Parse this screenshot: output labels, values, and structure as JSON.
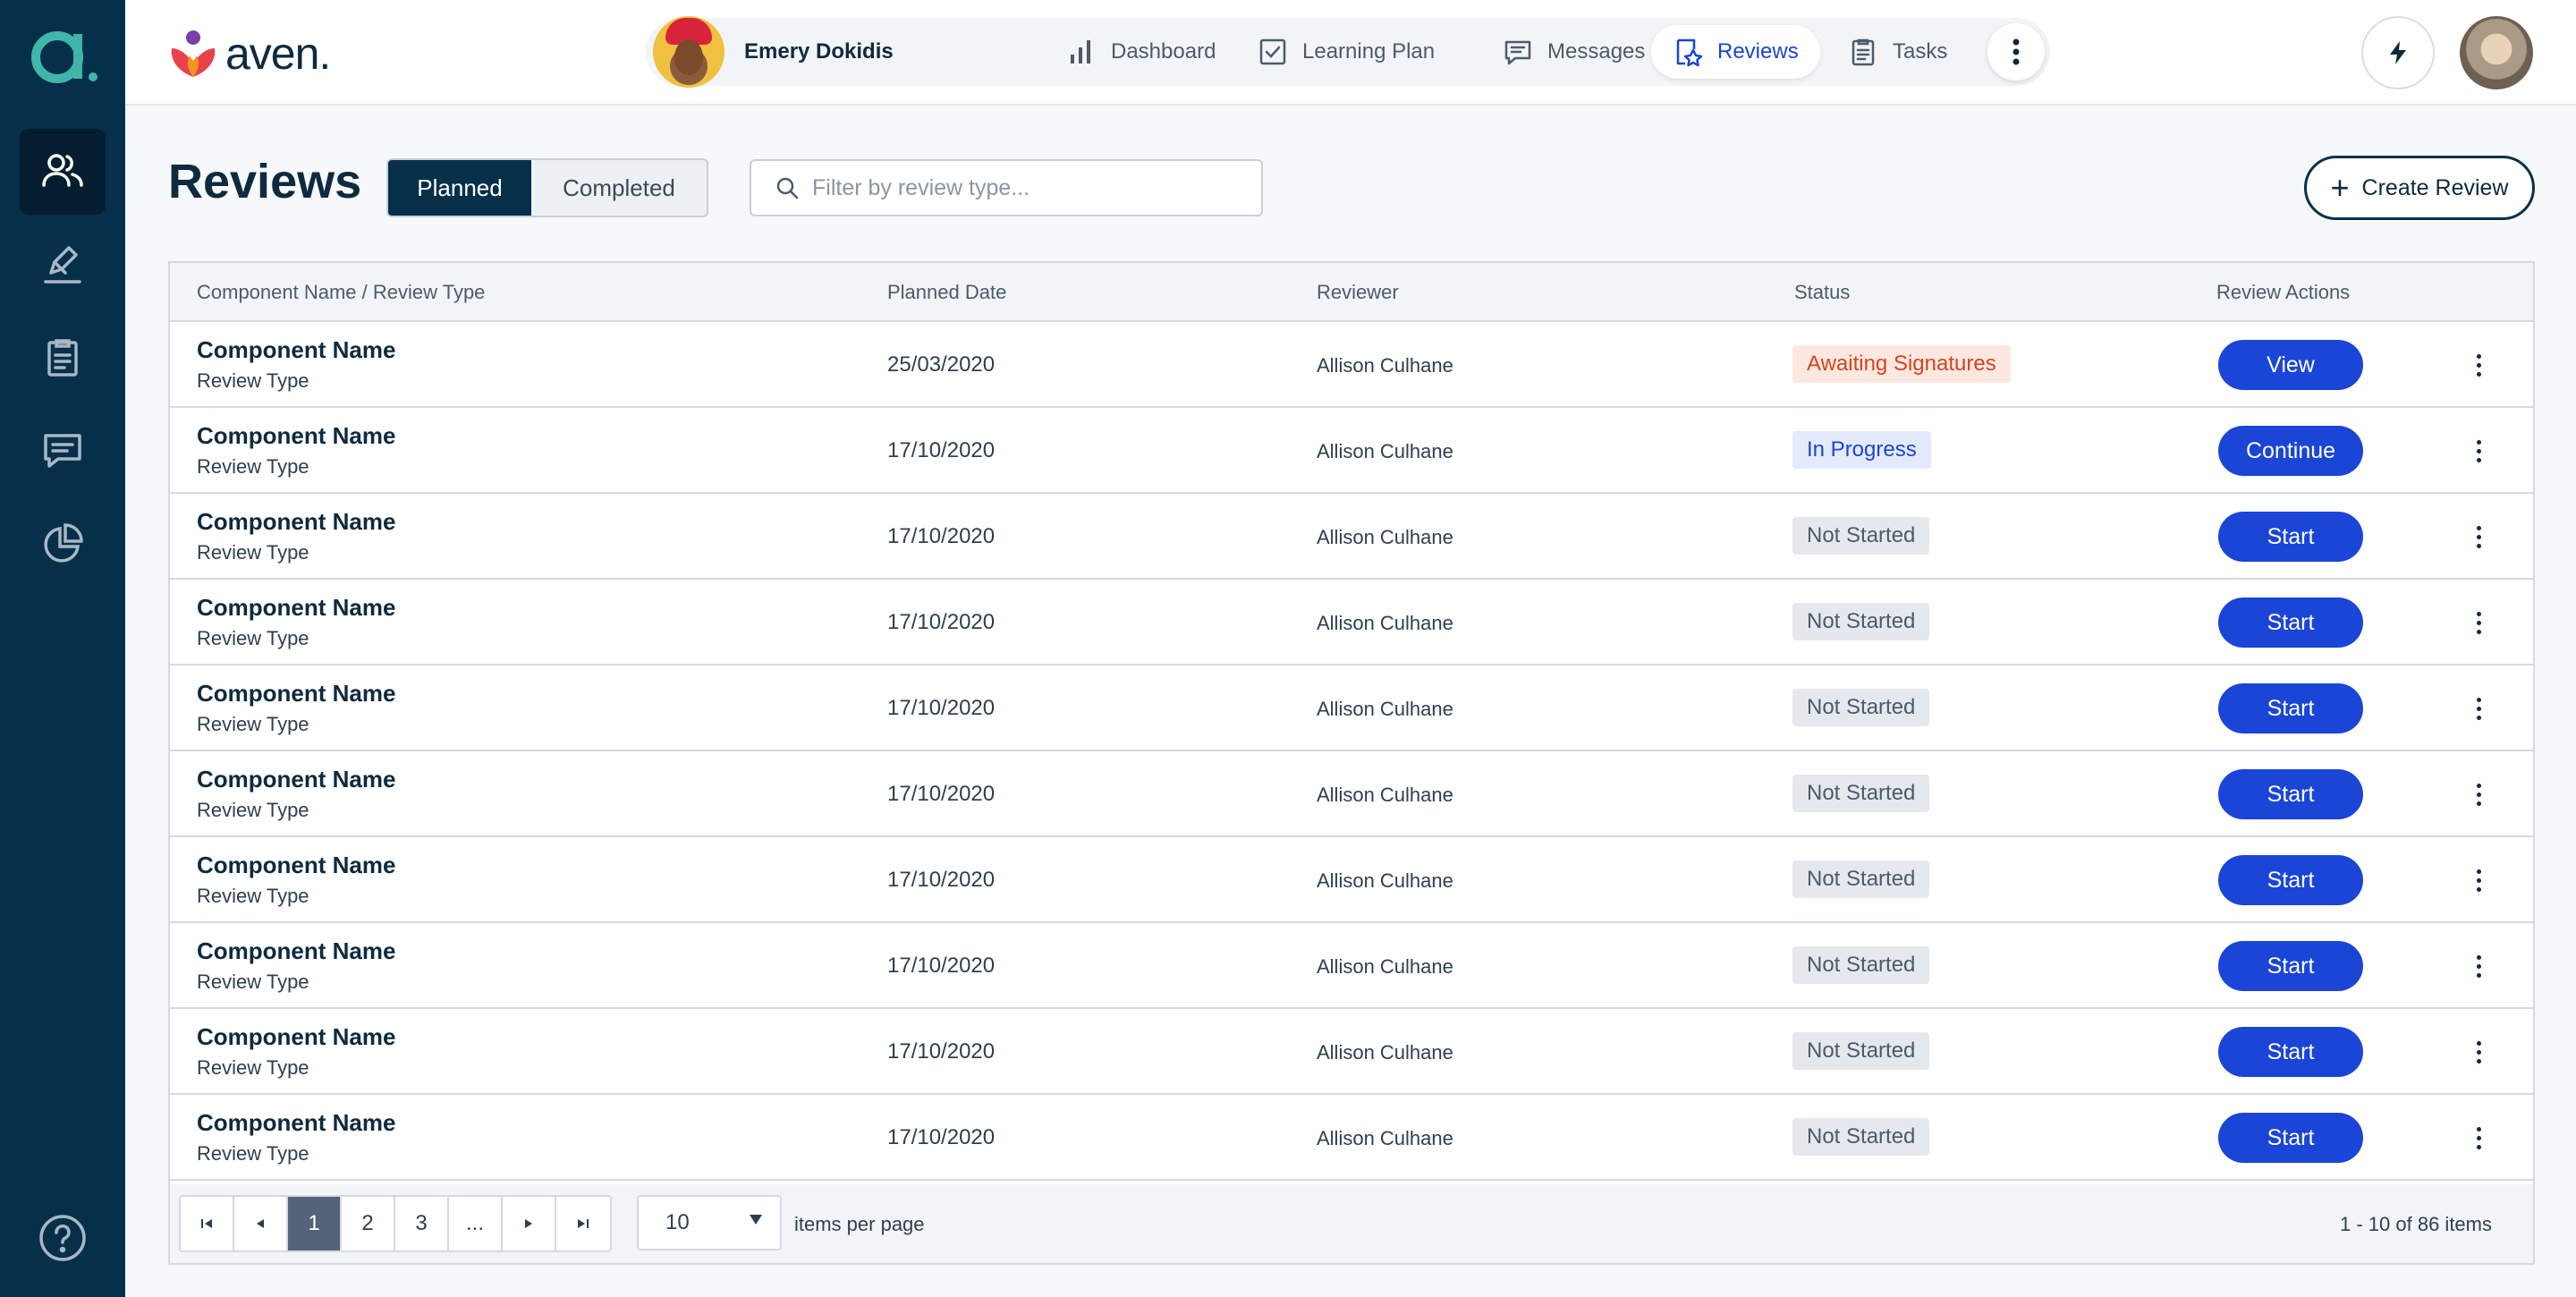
{
  "brand": {
    "name": "aven."
  },
  "nav": {
    "user_name": "Emery Dokidis",
    "items": [
      {
        "label": "Dashboard",
        "icon": "bar-chart-icon"
      },
      {
        "label": "Learning Plan",
        "icon": "checkbox-icon"
      },
      {
        "label": "Messages",
        "icon": "chat-icon"
      },
      {
        "label": "Reviews",
        "icon": "review-star-icon",
        "active": true
      },
      {
        "label": "Tasks",
        "icon": "clipboard-icon"
      }
    ]
  },
  "page": {
    "title": "Reviews",
    "segments": {
      "planned": "Planned",
      "completed": "Completed"
    },
    "filter_placeholder": "Filter by review type...",
    "create_label": "Create Review"
  },
  "table": {
    "headers": {
      "name": "Component Name / Review Type",
      "date": "Planned Date",
      "reviewer": "Reviewer",
      "status": "Status",
      "actions": "Review Actions"
    },
    "rows": [
      {
        "name": "Component Name",
        "type": "Review Type",
        "date": "25/03/2020",
        "reviewer": "Allison Culhane",
        "status": "Awaiting Signatures",
        "action": "View"
      },
      {
        "name": "Component Name",
        "type": "Review Type",
        "date": "17/10/2020",
        "reviewer": "Allison Culhane",
        "status": "In Progress",
        "action": "Continue"
      },
      {
        "name": "Component Name",
        "type": "Review Type",
        "date": "17/10/2020",
        "reviewer": "Allison Culhane",
        "status": "Not Started",
        "action": "Start"
      },
      {
        "name": "Component Name",
        "type": "Review Type",
        "date": "17/10/2020",
        "reviewer": "Allison Culhane",
        "status": "Not Started",
        "action": "Start"
      },
      {
        "name": "Component Name",
        "type": "Review Type",
        "date": "17/10/2020",
        "reviewer": "Allison Culhane",
        "status": "Not Started",
        "action": "Start"
      },
      {
        "name": "Component Name",
        "type": "Review Type",
        "date": "17/10/2020",
        "reviewer": "Allison Culhane",
        "status": "Not Started",
        "action": "Start"
      },
      {
        "name": "Component Name",
        "type": "Review Type",
        "date": "17/10/2020",
        "reviewer": "Allison Culhane",
        "status": "Not Started",
        "action": "Start"
      },
      {
        "name": "Component Name",
        "type": "Review Type",
        "date": "17/10/2020",
        "reviewer": "Allison Culhane",
        "status": "Not Started",
        "action": "Start"
      },
      {
        "name": "Component Name",
        "type": "Review Type",
        "date": "17/10/2020",
        "reviewer": "Allison Culhane",
        "status": "Not Started",
        "action": "Start"
      },
      {
        "name": "Component Name",
        "type": "Review Type",
        "date": "17/10/2020",
        "reviewer": "Allison Culhane",
        "status": "Not Started",
        "action": "Start"
      }
    ]
  },
  "status_colors": {
    "Awaiting Signatures": {
      "bg": "#fde8e1",
      "fg": "#d2461c"
    },
    "In Progress": {
      "bg": "#e3eafb",
      "fg": "#1a45d6"
    },
    "Not Started": {
      "bg": "#e5e8ec",
      "fg": "#4b5b6b"
    }
  },
  "pagination": {
    "pages": [
      "1",
      "2",
      "3",
      "..."
    ],
    "per_page": "10",
    "per_page_label": "items per page",
    "info": "1 - 10 of 86 items"
  },
  "colors": {
    "rail": "#06304a",
    "accent": "#1a45d6"
  }
}
